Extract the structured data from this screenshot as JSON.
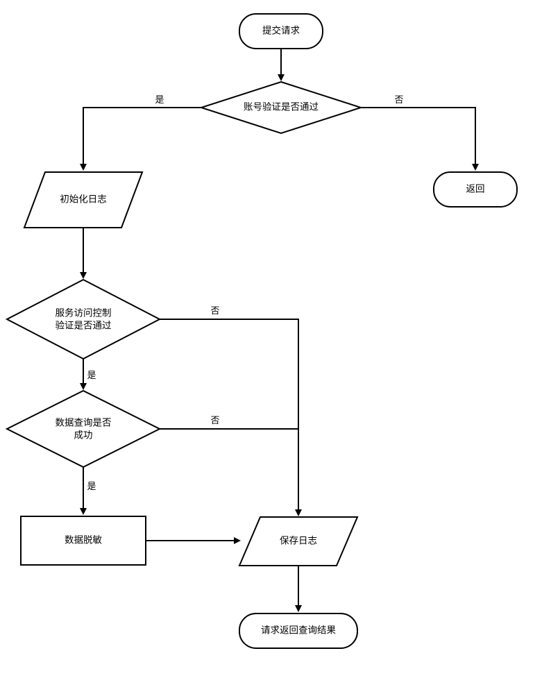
{
  "nodes": {
    "start": {
      "label": "提交请求"
    },
    "d_acct": {
      "line1": "账号验证是否通过"
    },
    "return": {
      "label": "返回"
    },
    "p_init": {
      "label": "初始化日志"
    },
    "d_svc": {
      "line1": "服务访问控制",
      "line2": "验证是否通过"
    },
    "d_query": {
      "line1": "数据查询是否",
      "line2": "成功"
    },
    "r_mask": {
      "label": "数据脱敏"
    },
    "p_save": {
      "label": "保存日志"
    },
    "end": {
      "label": "请求返回查询结果"
    }
  },
  "edges": {
    "yes": "是",
    "no": "否"
  }
}
